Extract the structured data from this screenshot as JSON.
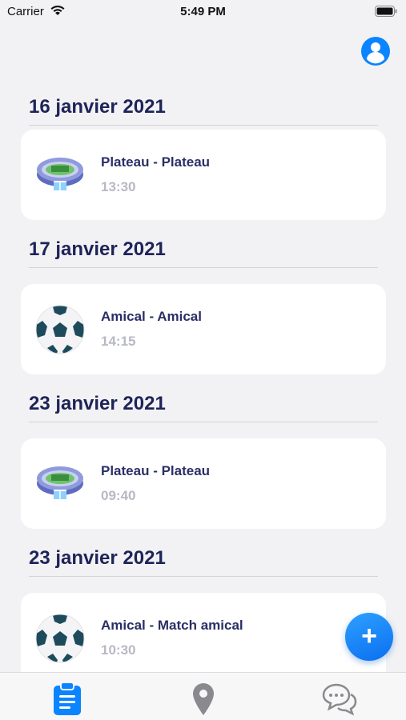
{
  "status_bar": {
    "carrier": "Carrier",
    "time": "5:49 PM"
  },
  "icons": {
    "profile": "person-circle-icon",
    "stadium": "stadium-icon",
    "ball": "soccer-ball-icon",
    "fab": "plus-icon",
    "tab_calendar": "clipboard-icon",
    "tab_map": "map-pin-icon",
    "tab_chat": "chat-bubbles-icon"
  },
  "colors": {
    "accent": "#0a84ff",
    "heading": "#1e2458",
    "time_text": "#b7b9c4"
  },
  "sections": [
    {
      "date": "16 janvier 2021",
      "event": {
        "title": "Plateau - Plateau",
        "time": "13:30",
        "icon": "stadium-icon"
      }
    },
    {
      "date": "17 janvier 2021",
      "event": {
        "title": "Amical - Amical",
        "time": "14:15",
        "icon": "soccer-ball-icon"
      }
    },
    {
      "date": "23 janvier 2021",
      "event": {
        "title": "Plateau - Plateau",
        "time": "09:40",
        "icon": "stadium-icon"
      }
    },
    {
      "date": "23 janvier 2021",
      "event": {
        "title": "Amical - Match amical",
        "time": "10:30",
        "icon": "soccer-ball-icon"
      }
    }
  ],
  "fab": {
    "label": "+"
  }
}
